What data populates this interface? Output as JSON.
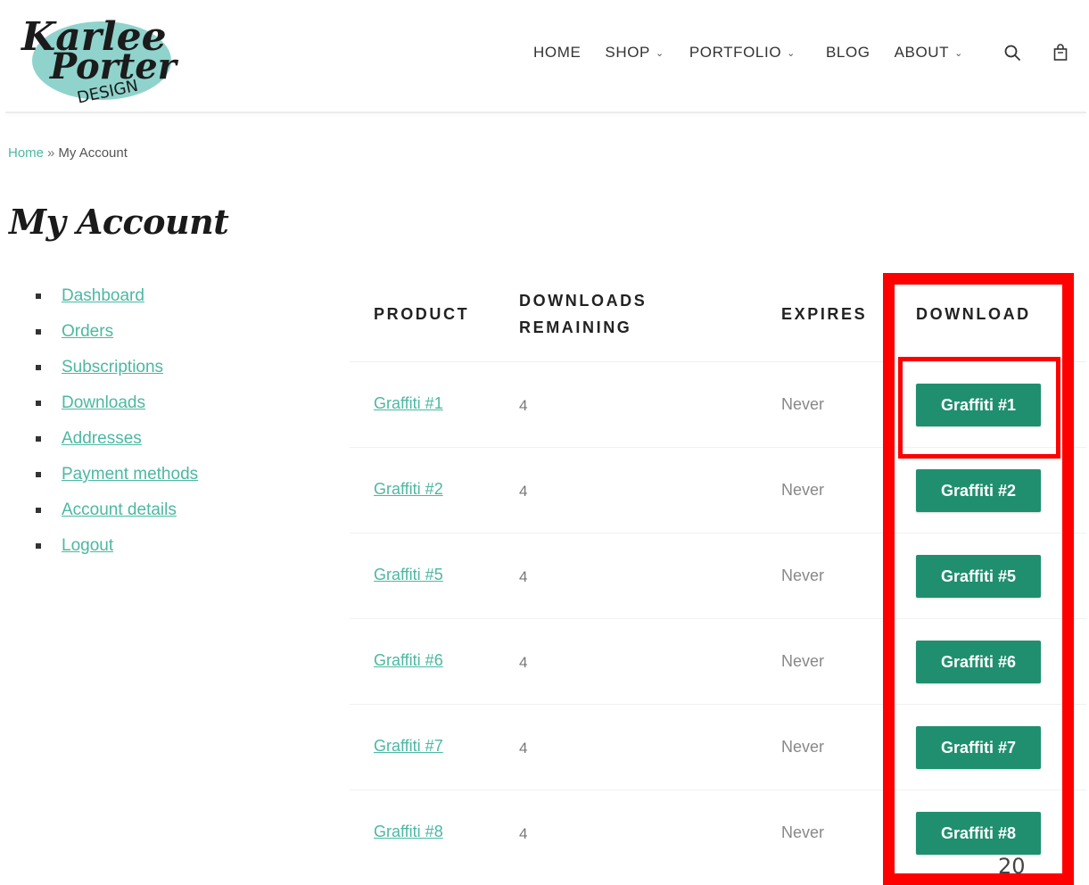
{
  "logo": {
    "text_line1": "Karlee",
    "text_line2": "Porter",
    "text_line3": "DESIGN",
    "accent": "#8fd3cc"
  },
  "nav": {
    "home": "HOME",
    "shop": "SHOP",
    "portfolio": "PORTFOLIO",
    "blog": "BLOG",
    "about": "ABOUT",
    "search_icon": "search-icon",
    "cart_icon": "shopping-bag-icon"
  },
  "breadcrumb": {
    "home": "Home",
    "separator": "»",
    "current": "My Account"
  },
  "page_title": "My Account",
  "account_nav": {
    "items": [
      {
        "label": "Dashboard"
      },
      {
        "label": "Orders"
      },
      {
        "label": "Subscriptions"
      },
      {
        "label": "Downloads"
      },
      {
        "label": "Addresses"
      },
      {
        "label": "Payment methods"
      },
      {
        "label": "Account details"
      },
      {
        "label": "Logout"
      }
    ]
  },
  "table": {
    "headers": {
      "product": "PRODUCT",
      "remaining_line1": "DOWNLOADS",
      "remaining_line2": "REMAINING",
      "expires": "EXPIRES",
      "download": "DOWNLOAD"
    },
    "rows": [
      {
        "product": "Graffiti #1",
        "remaining": "4",
        "expires": "Never",
        "download": "Graffiti #1"
      },
      {
        "product": "Graffiti #2",
        "remaining": "4",
        "expires": "Never",
        "download": "Graffiti #2"
      },
      {
        "product": "Graffiti #5",
        "remaining": "4",
        "expires": "Never",
        "download": "Graffiti #5"
      },
      {
        "product": "Graffiti #6",
        "remaining": "4",
        "expires": "Never",
        "download": "Graffiti #6"
      },
      {
        "product": "Graffiti #7",
        "remaining": "4",
        "expires": "Never",
        "download": "Graffiti #7"
      },
      {
        "product": "Graffiti #8",
        "remaining": "4",
        "expires": "Never",
        "download": "Graffiti #8"
      }
    ]
  },
  "page_number": "20",
  "colors": {
    "link": "#4cb8a2",
    "button": "#1f8f6f",
    "highlight": "#ff0000"
  }
}
